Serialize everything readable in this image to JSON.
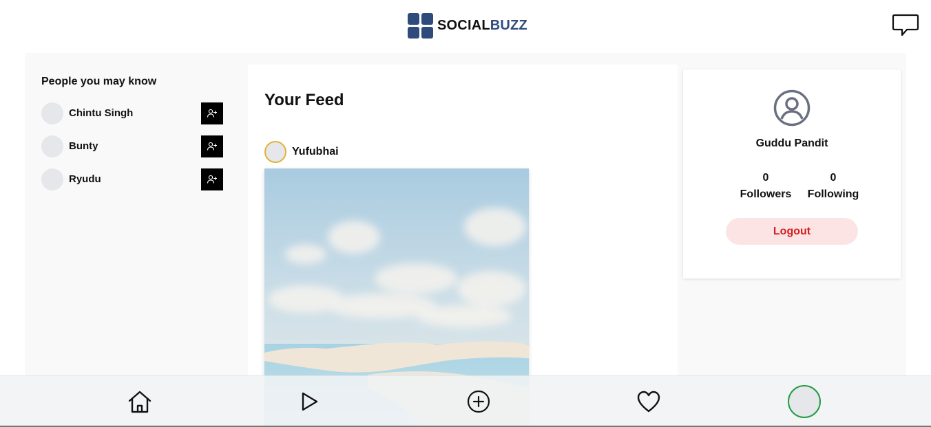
{
  "app": {
    "logo_part1": "SOCIAL",
    "logo_part2": "BUZZ"
  },
  "header": {
    "chat_icon": "chat-bubble-icon"
  },
  "suggestions": {
    "title": "People you may know",
    "people": [
      {
        "name": "Chintu Singh",
        "action_icon": "add-user-icon"
      },
      {
        "name": "Bunty",
        "action_icon": "add-user-icon"
      },
      {
        "name": "Ryudu",
        "action_icon": "add-user-icon"
      }
    ]
  },
  "feed": {
    "title": "Your Feed",
    "posts": [
      {
        "author": "Yufubhai",
        "image": "sky-clouds-sand-dunes-lagoon"
      }
    ]
  },
  "profile": {
    "icon": "user-circle-icon",
    "name": "Guddu Pandit",
    "followers_count": "0",
    "followers_label": "Followers",
    "following_count": "0",
    "following_label": "Following",
    "logout_label": "Logout"
  },
  "bottom_nav": {
    "items": [
      "home-icon",
      "play-icon",
      "add-post-icon",
      "heart-icon",
      "profile-avatar"
    ]
  },
  "colors": {
    "brand": "#2f4b7c",
    "logout_text": "#d42020",
    "logout_bg": "#fde4e4",
    "story_ring": "#e2b33a",
    "profile_ring": "#1f9d45"
  }
}
